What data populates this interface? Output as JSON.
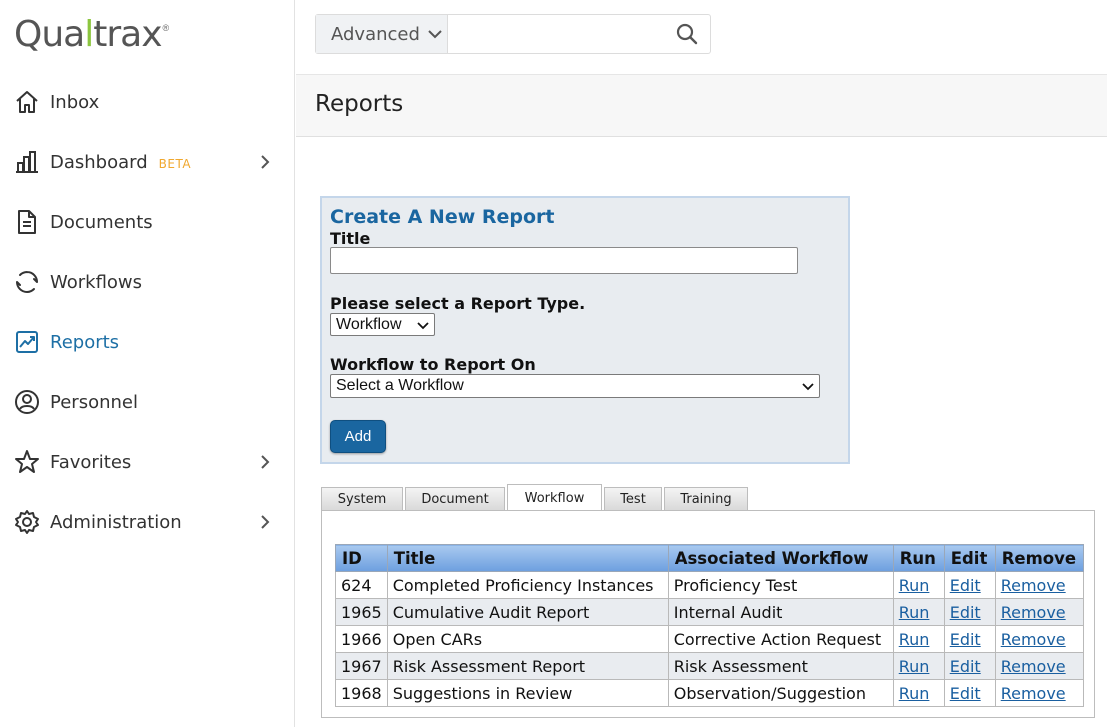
{
  "app": {
    "logo_parts": {
      "q": "Qua",
      "l": "l",
      "rest": "trax",
      "reg": "®"
    }
  },
  "sidebar": {
    "items": [
      {
        "label": "Inbox",
        "icon": "home-icon"
      },
      {
        "label": "Dashboard",
        "icon": "bar-chart-icon",
        "badge": "BETA",
        "has_children": true
      },
      {
        "label": "Documents",
        "icon": "document-icon"
      },
      {
        "label": "Workflows",
        "icon": "cycle-icon"
      },
      {
        "label": "Reports",
        "icon": "report-chart-icon",
        "active": true
      },
      {
        "label": "Personnel",
        "icon": "person-icon"
      },
      {
        "label": "Favorites",
        "icon": "star-icon",
        "has_children": true
      },
      {
        "label": "Administration",
        "icon": "gear-icon",
        "has_children": true
      }
    ]
  },
  "search": {
    "scope_label": "Advanced",
    "value": "",
    "placeholder": ""
  },
  "page": {
    "title": "Reports"
  },
  "create_report": {
    "heading": "Create A New Report",
    "title_label": "Title",
    "title_value": "",
    "type_label": "Please select a Report Type.",
    "type_selected": "Workflow",
    "workflow_label": "Workflow to Report On",
    "workflow_selected": "Select a Workflow",
    "add_label": "Add"
  },
  "tabs": [
    {
      "label": "System"
    },
    {
      "label": "Document"
    },
    {
      "label": "Workflow",
      "active": true
    },
    {
      "label": "Test"
    },
    {
      "label": "Training"
    }
  ],
  "reports_table": {
    "headers": [
      "ID",
      "Title",
      "Associated Workflow",
      "Run",
      "Edit",
      "Remove"
    ],
    "rows": [
      {
        "id": "624",
        "title": "Completed Proficiency Instances",
        "workflow": "Proficiency Test",
        "run": "Run",
        "edit": "Edit",
        "remove": "Remove"
      },
      {
        "id": "1965",
        "title": "Cumulative Audit Report",
        "workflow": "Internal Audit",
        "run": "Run",
        "edit": "Edit",
        "remove": "Remove"
      },
      {
        "id": "1966",
        "title": "Open CARs",
        "workflow": "Corrective Action Request",
        "run": "Run",
        "edit": "Edit",
        "remove": "Remove"
      },
      {
        "id": "1967",
        "title": "Risk Assessment Report",
        "workflow": "Risk Assessment",
        "run": "Run",
        "edit": "Edit",
        "remove": "Remove"
      },
      {
        "id": "1968",
        "title": "Suggestions in Review",
        "workflow": "Observation/Suggestion",
        "run": "Run",
        "edit": "Edit",
        "remove": "Remove"
      }
    ]
  },
  "colors": {
    "brand_green": "#8cc63f",
    "active_blue": "#1d6fa5",
    "beta_orange": "#f0a830",
    "button_blue": "#1a66a0"
  }
}
